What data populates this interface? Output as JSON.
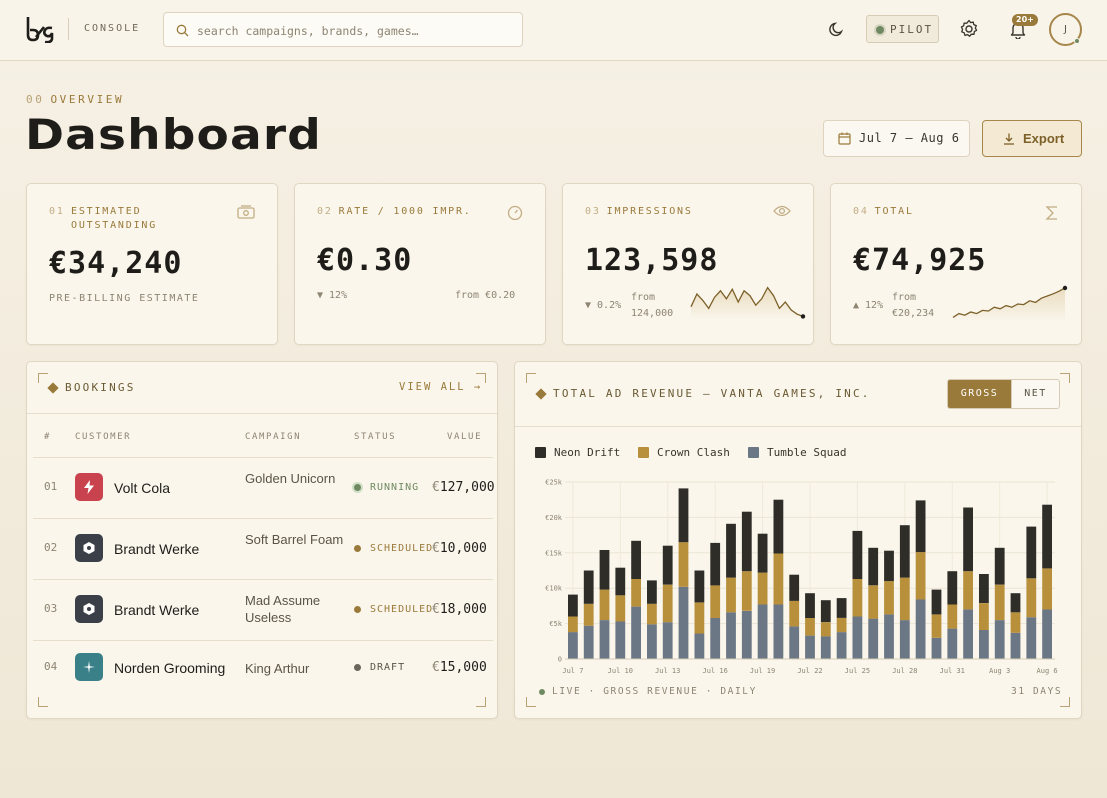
{
  "app": {
    "section_label": "CONSOLE",
    "search_placeholder": "search campaigns, brands, games…",
    "mode_label": "PILOT",
    "notification_count": "20+",
    "avatar_initial": "J"
  },
  "header": {
    "overview_num": "00",
    "overview_label": "OVERVIEW",
    "title": "Dashboard",
    "date_range": "Jul 7 — Aug 6",
    "export_label": "Export"
  },
  "kpis": [
    {
      "num": "01",
      "label": "ESTIMATED OUTSTANDING",
      "value": "€34,240",
      "note": "PRE-BILLING ESTIMATE",
      "icon": "money-icon"
    },
    {
      "num": "02",
      "label": "RATE / 1000 IMPR.",
      "value": "€0.30",
      "trend": "▼ 12%",
      "from": "from €0.20",
      "icon": "gauge-icon"
    },
    {
      "num": "03",
      "label": "IMPRESSIONS",
      "value": "123,598",
      "trend": "▼ 0.2%",
      "from_line1": "from",
      "from_line2": "124,000",
      "icon": "eye-icon"
    },
    {
      "num": "04",
      "label": "TOTAL",
      "value": "€74,925",
      "trend": "▲ 12%",
      "from_line1": "from",
      "from_line2": "€20,234",
      "icon": "sigma-icon"
    }
  ],
  "bookings": {
    "title": "BOOKINGS",
    "view_all": "VIEW ALL →",
    "columns": [
      "#",
      "CUSTOMER",
      "CAMPAIGN",
      "STATUS",
      "VALUE"
    ],
    "rows": [
      {
        "idx": "01",
        "customer": "Volt Cola",
        "campaign": "Golden Unicorn",
        "status": "RUNNING",
        "value": "127,000",
        "currency": "€",
        "icon": "bolt-icon",
        "icon_color": "#c9434e",
        "status_color": "#6f8a62"
      },
      {
        "idx": "02",
        "customer": "Brandt Werke",
        "campaign": "Soft Barrel Foam",
        "status": "SCHEDULED",
        "value": "10,000",
        "currency": "€",
        "icon": "hexagon-icon",
        "icon_color": "#3b3f47",
        "status_color": "#9a7a3a"
      },
      {
        "idx": "03",
        "customer": "Brandt Werke",
        "campaign": "Mad Assume Useless",
        "status": "SCHEDULED",
        "value": "18,000",
        "currency": "€",
        "icon": "hexagon-icon",
        "icon_color": "#3b3f47",
        "status_color": "#9a7a3a"
      },
      {
        "idx": "04",
        "customer": "Norden Grooming",
        "campaign": "King Arthur",
        "status": "DRAFT",
        "value": "15,000",
        "currency": "€",
        "icon": "sparkle-icon",
        "icon_color": "#3a8088",
        "status_color": "#5b5446"
      }
    ]
  },
  "revenue": {
    "title": "TOTAL AD REVENUE — VANTA GAMES, INC.",
    "toggle": [
      "GROSS",
      "NET"
    ],
    "footer_live": "LIVE · GROSS REVENUE · DAILY",
    "footer_days": "31 DAYS"
  },
  "chart_data": {
    "type": "bar",
    "stacked": true,
    "categories": [
      "Jul 7",
      "Jul 8",
      "Jul 9",
      "Jul 10",
      "Jul 11",
      "Jul 12",
      "Jul 13",
      "Jul 14",
      "Jul 15",
      "Jul 16",
      "Jul 17",
      "Jul 18",
      "Jul 19",
      "Jul 20",
      "Jul 21",
      "Jul 22",
      "Jul 23",
      "Jul 24",
      "Jul 25",
      "Jul 26",
      "Jul 27",
      "Jul 28",
      "Jul 29",
      "Jul 30",
      "Jul 31",
      "Aug 1",
      "Aug 2",
      "Aug 3",
      "Aug 4",
      "Aug 5",
      "Aug 6"
    ],
    "tick_labels": [
      "Jul 7",
      "Jul 10",
      "Jul 13",
      "Jul 16",
      "Jul 19",
      "Jul 22",
      "Jul 25",
      "Jul 28",
      "Jul 31",
      "Aug 3",
      "Aug 6"
    ],
    "y_ticks": [
      "0",
      "€5k",
      "€10k",
      "€15k",
      "€20k",
      "€25k"
    ],
    "ylim": [
      0,
      25000
    ],
    "legend_position": "top-left",
    "series": [
      {
        "name": "Tumble Squad",
        "color": "#6b7784",
        "values": [
          3800,
          4700,
          5500,
          5300,
          7400,
          4900,
          5200,
          10200,
          3600,
          5800,
          6600,
          6800,
          7700,
          7700,
          4600,
          3300,
          3200,
          3800,
          6000,
          5700,
          6300,
          5500,
          8400,
          3000,
          4300,
          7000,
          4100,
          5500,
          3700,
          5900,
          7000
        ]
      },
      {
        "name": "Crown Clash",
        "color": "#b8903c",
        "values": [
          2200,
          3100,
          4300,
          3700,
          3900,
          2900,
          5300,
          6300,
          4400,
          4600,
          4900,
          5600,
          4500,
          7200,
          3600,
          2500,
          2000,
          2000,
          5300,
          4700,
          4700,
          6000,
          6700,
          3300,
          3400,
          5400,
          3800,
          5000,
          2900,
          5500,
          5800
        ]
      },
      {
        "name": "Neon Drift",
        "color": "#2f2d28",
        "values": [
          3100,
          4700,
          5600,
          3900,
          5400,
          3300,
          5500,
          7600,
          4500,
          6000,
          7600,
          8400,
          5500,
          7600,
          3700,
          3500,
          3100,
          2800,
          6800,
          5300,
          4300,
          7400,
          7300,
          3500,
          4700,
          9000,
          4100,
          5200,
          2700,
          7300,
          9000
        ]
      }
    ]
  },
  "kpi_sparks": {
    "impressions": [
      0.35,
      0.75,
      0.55,
      0.3,
      0.65,
      0.85,
      0.6,
      0.9,
      0.5,
      0.85,
      0.7,
      0.4,
      0.6,
      0.95,
      0.7,
      0.3,
      0.5,
      0.25,
      0.12,
      0.05
    ],
    "total": [
      0.08,
      0.2,
      0.15,
      0.25,
      0.2,
      0.3,
      0.28,
      0.4,
      0.35,
      0.45,
      0.4,
      0.5,
      0.48,
      0.6,
      0.55,
      0.68,
      0.75,
      0.82,
      0.9,
      1.0
    ]
  },
  "colors": {
    "accent": "#9a7a3a",
    "ink": "#1f1d19",
    "positive": "#6f8a62"
  }
}
